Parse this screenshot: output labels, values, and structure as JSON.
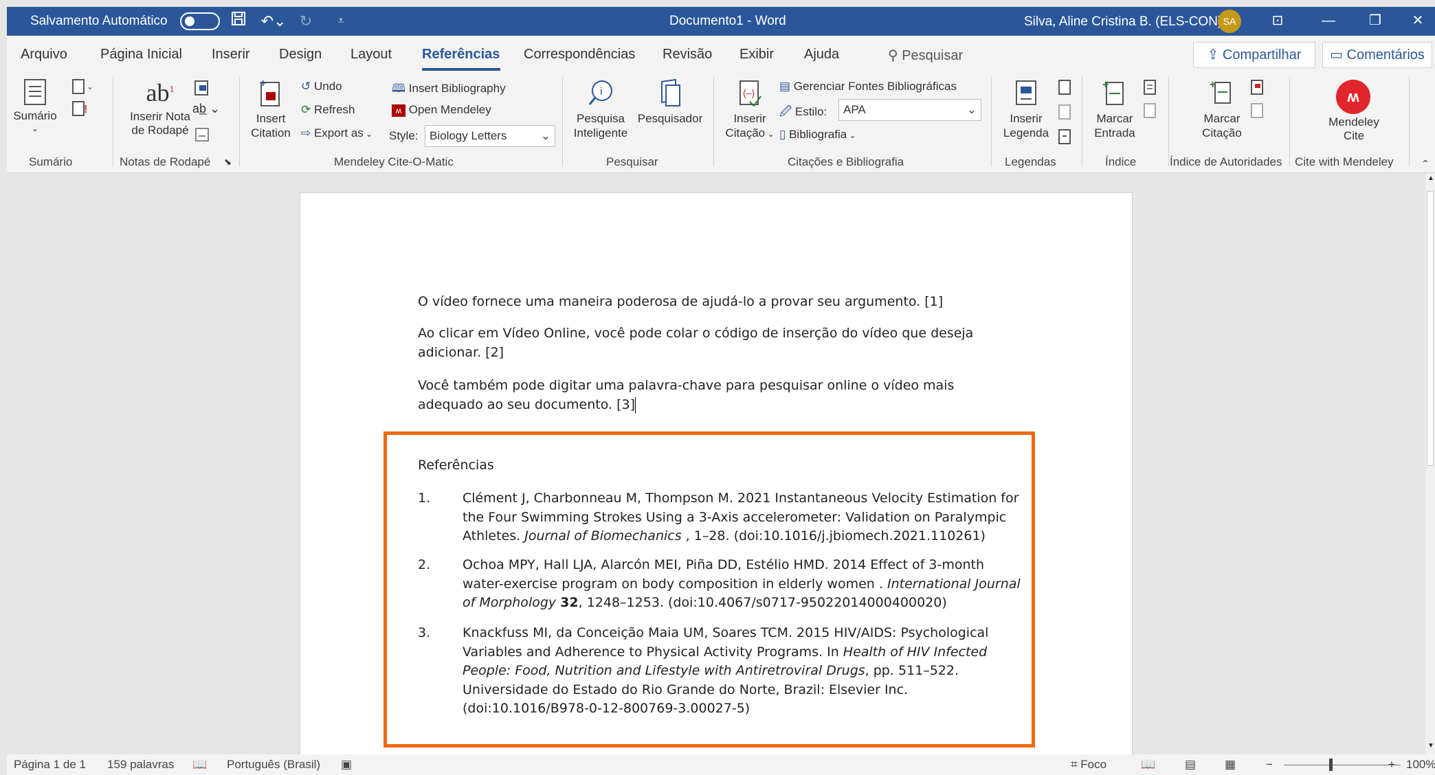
{
  "titlebar": {
    "autosave_label": "Salvamento Automático",
    "autosave_state": "off",
    "doc_title": "Documento1  -  Word",
    "user": "Silva, Aline Cristina B. (ELS-CON)",
    "avatar": "SA"
  },
  "menu": {
    "tabs": [
      "Arquivo",
      "Página Inicial",
      "Inserir",
      "Design",
      "Layout",
      "Referências",
      "Correspondências",
      "Revisão",
      "Exibir",
      "Ajuda"
    ],
    "active_tab": "Referências",
    "search_label": "Pesquisar",
    "share_label": "Compartilhar",
    "comments_label": "Comentários"
  },
  "ribbon": {
    "sumario": {
      "button": "Sumário",
      "group": "Sumário"
    },
    "notas": {
      "insert_note_line1": "Inserir Nota",
      "insert_note_line2": "de Rodapé",
      "group": "Notas de Rodapé"
    },
    "mendeley": {
      "insert_citation_line1": "Insert",
      "insert_citation_line2": "Citation",
      "undo": "Undo",
      "refresh": "Refresh",
      "export": "Export as",
      "insert_bibliography": "Insert Bibliography",
      "open_mendeley": "Open Mendeley",
      "style_label": "Style:",
      "style_value": "Biology Letters",
      "group": "Mendeley Cite-O-Matic"
    },
    "pesquisar": {
      "smart_line1": "Pesquisa",
      "smart_line2": "Inteligente",
      "researcher": "Pesquisador",
      "group": "Pesquisar"
    },
    "citacoes": {
      "insert_line1": "Inserir",
      "insert_line2": "Citação",
      "manage_sources": "Gerenciar Fontes Bibliográficas",
      "style_label": "Estilo:",
      "style_value": "APA",
      "bibliography": "Bibliografia",
      "group": "Citações e Bibliografia"
    },
    "legendas": {
      "insert_line1": "Inserir",
      "insert_line2": "Legenda",
      "group": "Legendas"
    },
    "indice": {
      "mark_line1": "Marcar",
      "mark_line2": "Entrada",
      "group": "Índice"
    },
    "autoridades": {
      "mark_line1": "Marcar",
      "mark_line2": "Citação",
      "group": "Índice de Autoridades"
    },
    "mendeley_cite": {
      "line1": "Mendeley",
      "line2": "Cite",
      "group": "Cite with Mendeley"
    }
  },
  "document": {
    "paragraphs": [
      "O vídeo fornece uma maneira poderosa de ajudá-lo a provar seu argumento. [1]",
      "Ao clicar em Vídeo Online, você pode colar o código de inserção do vídeo que deseja adicionar. [2]",
      "Você também pode digitar uma palavra-chave para pesquisar online o vídeo mais adequado ao seu documento. [3]"
    ],
    "references_title": "Referências",
    "references": [
      {
        "num": "1.",
        "pre": "Clément J, Charbonneau M, Thompson M. 2021 Instantaneous Velocity Estimation for the Four Swimming Strokes Using a 3-Axis accelerometer: Validation on Paralympic Athletes. ",
        "italic": "Journal of Biomechanics",
        "bold": "",
        "post": " , 1–28. (doi:10.1016/j.jbiomech.2021.110261)"
      },
      {
        "num": "2.",
        "pre": "Ochoa MPY, Hall LJA, Alarcón MEI, Piña DD, Estélio HMD. 2014 Effect of 3-month water-exercise program on body composition in elderly women . ",
        "italic": "International Journal of Morphology",
        "bold": "32",
        "post": ", 1248–1253. (doi:10.4067/s0717-95022014000400020)"
      },
      {
        "num": "3.",
        "pre": "Knackfuss MI, da Conceição Maia UM, Soares TCM. 2015 HIV/AIDS: Psychological Variables and Adherence to Physical Activity Programs. In ",
        "italic": "Health of HIV Infected People: Food, Nutrition and Lifestyle with Antiretroviral Drugs",
        "bold": "",
        "post": ", pp. 511–522. Universidade do Estado do Rio Grande do Norte, Brazil: Elsevier Inc. (doi:10.1016/B978-0-12-800769-3.00027-5)"
      }
    ]
  },
  "status": {
    "page": "Página 1 de 1",
    "words": "159 palavras",
    "language": "Português (Brasil)",
    "focus": "Foco",
    "zoom": "100%"
  },
  "colors": {
    "title_bar": "#2b579a",
    "highlight_box": "#f26a0b",
    "mendeley_red": "#e0262c"
  }
}
